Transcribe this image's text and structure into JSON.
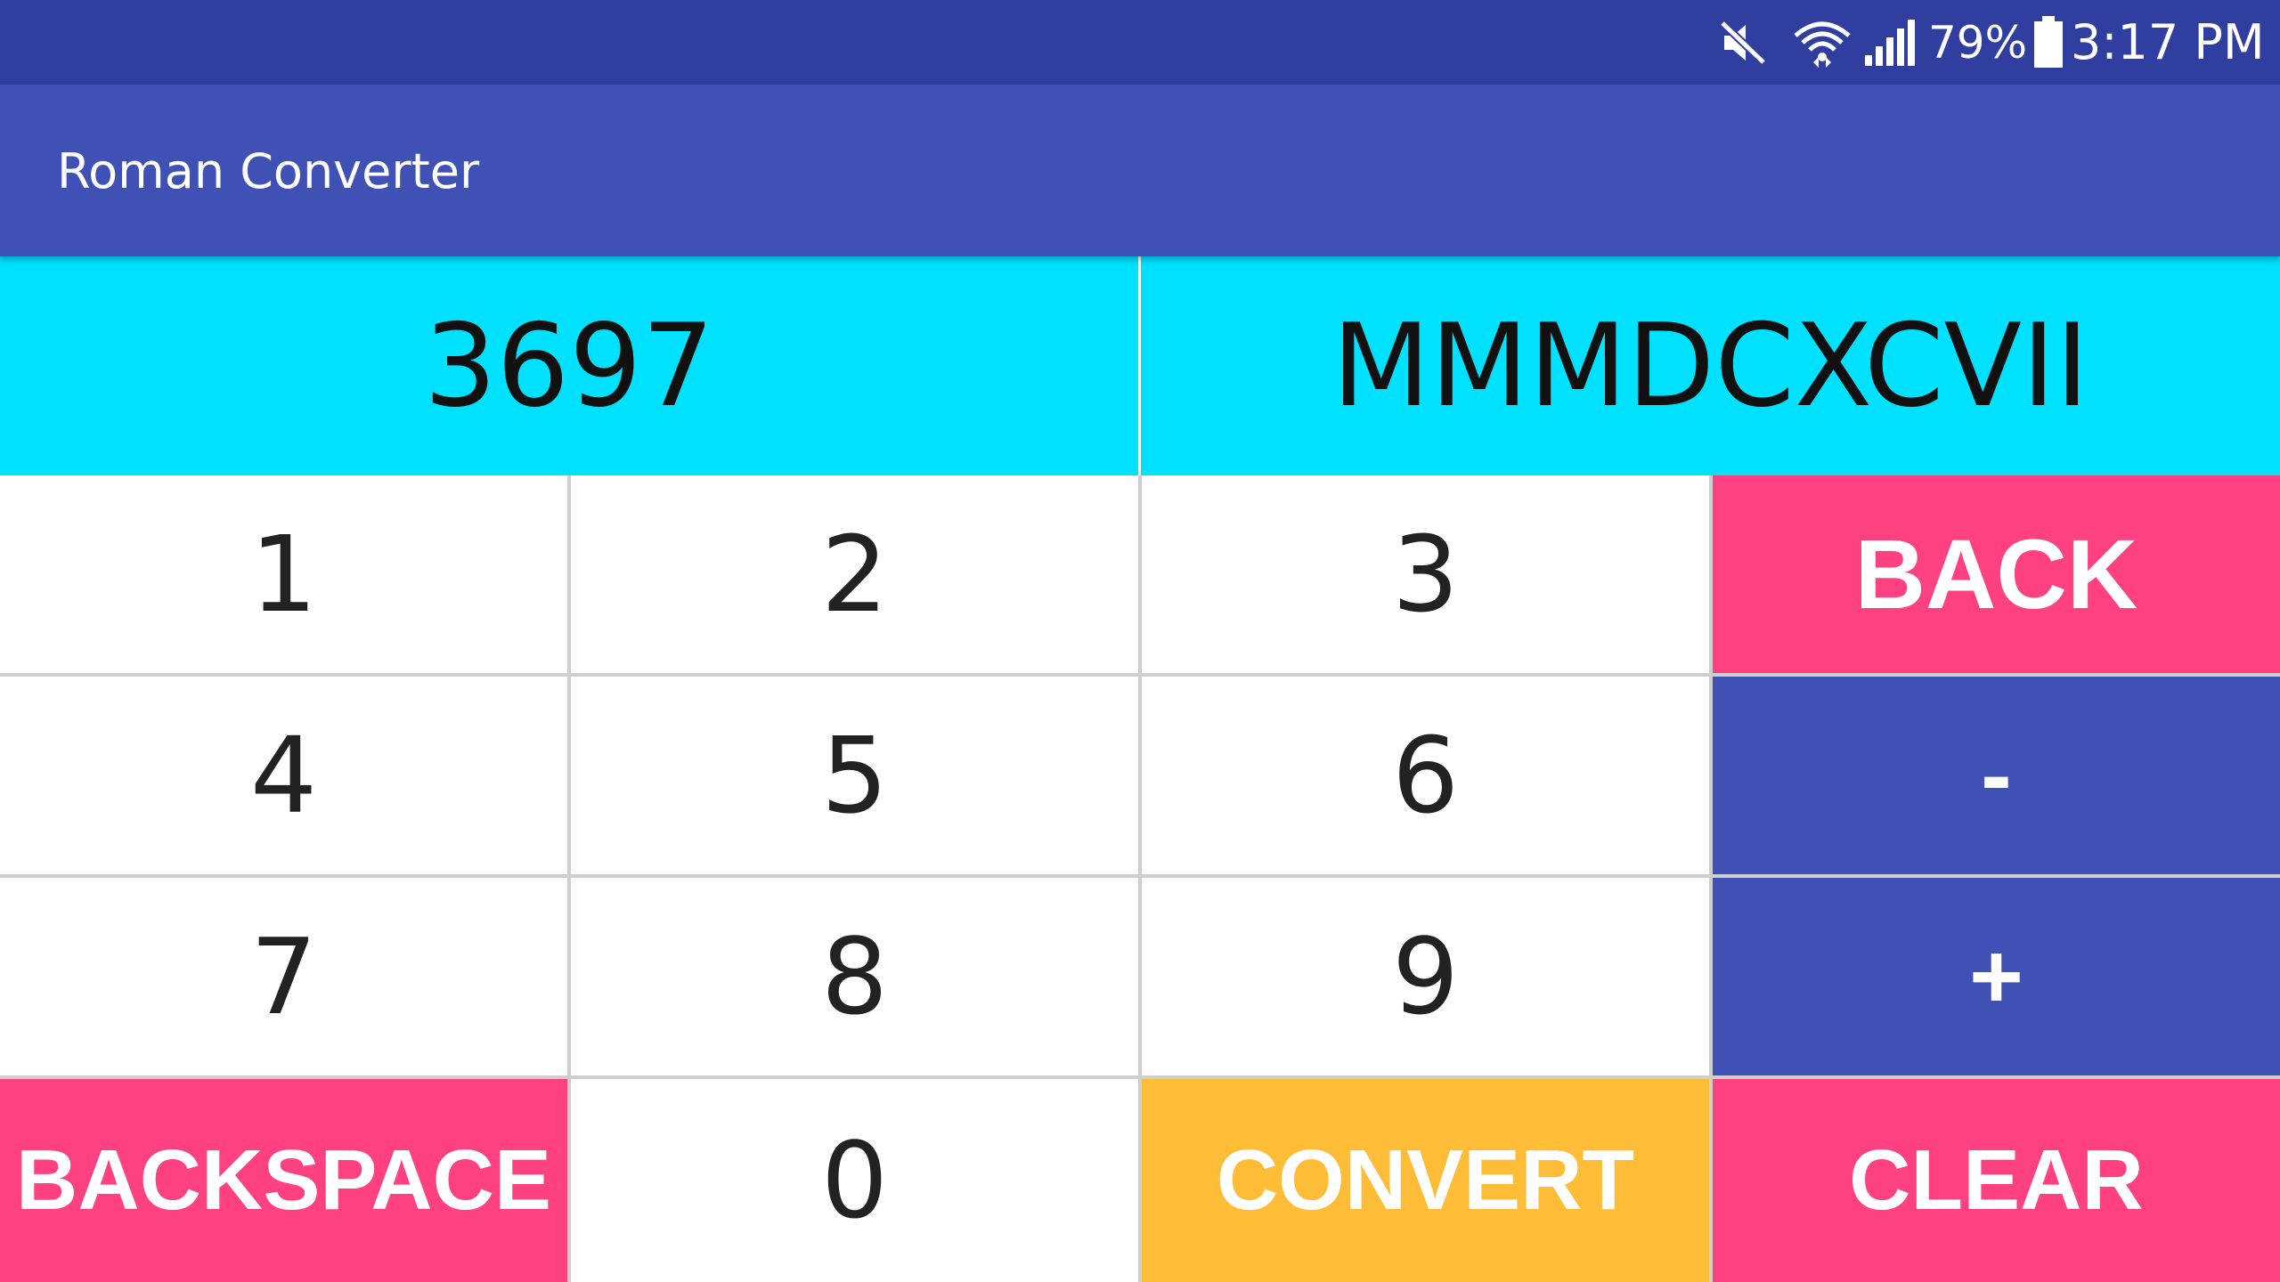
{
  "status_bar": {
    "battery_percent": "79%",
    "time": "3:17 PM",
    "icons": [
      "mute-icon",
      "wifi-icon",
      "signal-icon",
      "battery-icon"
    ]
  },
  "app_bar": {
    "title": "Roman Converter"
  },
  "display": {
    "arabic_value": "3697",
    "roman_value": "MMMDCXCVII"
  },
  "keypad": {
    "rows": [
      [
        "1",
        "2",
        "3",
        "BACK"
      ],
      [
        "4",
        "5",
        "6",
        "-"
      ],
      [
        "7",
        "8",
        "9",
        "+"
      ],
      [
        "BACKSPACE",
        "0",
        "CONVERT",
        "CLEAR"
      ]
    ]
  },
  "colors": {
    "status_bar": "#303f9f",
    "app_bar": "#3f51b5",
    "display_background": "#00e0ff",
    "accent_pink": "#ff4081",
    "action_indigo": "#3f51b5",
    "convert_amber": "#ffbc37"
  }
}
